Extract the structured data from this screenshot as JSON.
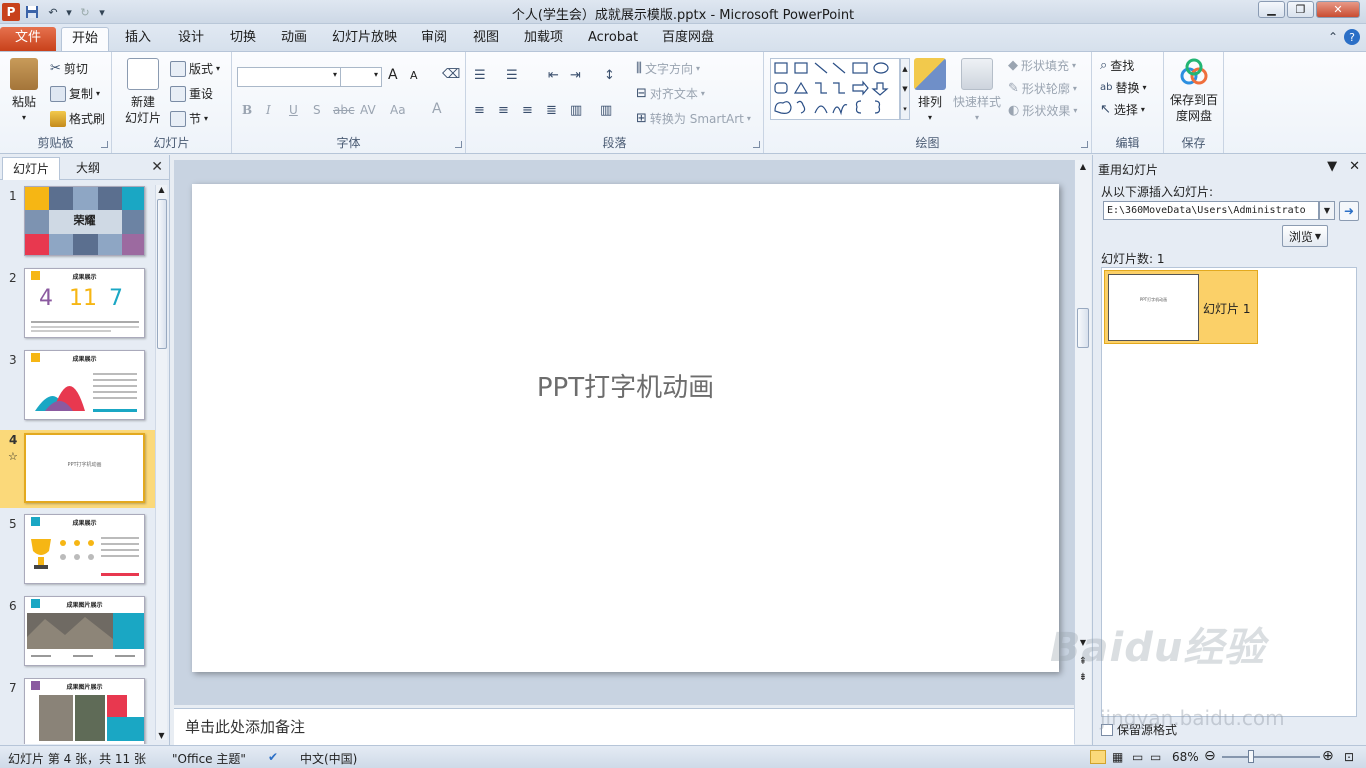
{
  "window": {
    "title": "个人(学生会）成就展示模版.pptx - Microsoft PowerPoint"
  },
  "qat": {
    "logo": "P",
    "save_icon": "save-icon",
    "undo_icon": "undo-icon",
    "redo_icon": "redo-icon"
  },
  "tabs": [
    "文件",
    "开始",
    "插入",
    "设计",
    "切换",
    "动画",
    "幻灯片放映",
    "审阅",
    "视图",
    "加载项",
    "Acrobat",
    "百度网盘"
  ],
  "active_tab": "开始",
  "ribbon": {
    "clipboard": {
      "label": "剪贴板",
      "paste": "粘贴",
      "cut": "剪切",
      "copy": "复制",
      "format_painter": "格式刷"
    },
    "slides": {
      "label": "幻灯片",
      "new_slide_1": "新建",
      "new_slide_2": "幻灯片",
      "layout": "版式",
      "reset": "重设",
      "section": "节"
    },
    "font": {
      "label": "字体",
      "grow": "A",
      "shrink": "A",
      "bold": "B",
      "italic": "I",
      "underline": "U",
      "shadow": "S",
      "strike": "abc",
      "spacing": "AV",
      "case": "Aa",
      "color": "A"
    },
    "paragraph": {
      "label": "段落",
      "text_direction": "文字方向",
      "align_text": "对齐文本",
      "smartart": "转换为 SmartArt"
    },
    "drawing": {
      "label": "绘图",
      "arrange": "排列",
      "quick_styles": "快速样式",
      "shape_fill": "形状填充",
      "shape_outline": "形状轮廓",
      "shape_effects": "形状效果"
    },
    "editing": {
      "label": "编辑",
      "find": "查找",
      "replace": "替换",
      "select": "选择"
    },
    "save": {
      "label": "保存",
      "save_baidu_1": "保存到百",
      "save_baidu_2": "度网盘"
    }
  },
  "left_pane": {
    "tabs": [
      "幻灯片",
      "大纲"
    ],
    "slides": [
      {
        "num": "1",
        "title": "荣耀"
      },
      {
        "num": "2",
        "title": "成果展示",
        "nums": [
          "4",
          "11",
          "7"
        ]
      },
      {
        "num": "3",
        "title": "成果展示"
      },
      {
        "num": "4",
        "title": "PPT打字机动画",
        "selected": true
      },
      {
        "num": "5",
        "title": "成果展示"
      },
      {
        "num": "6",
        "title": "成果图片展示"
      },
      {
        "num": "7",
        "title": "成果图片展示"
      }
    ],
    "selected_star": "☆"
  },
  "slide": {
    "title": "PPT打字机动画"
  },
  "notes": {
    "placeholder": "单击此处添加备注"
  },
  "right_pane": {
    "title": "重用幻灯片",
    "insert_from": "从以下源插入幻灯片:",
    "path": "E:\\360MoveData\\Users\\Administrato",
    "browse": "浏览",
    "count_label": "幻灯片数: 1",
    "item_label": "幻灯片 1",
    "item_preview": "PPT打字机动画",
    "keep_format": "保留源格式"
  },
  "status": {
    "slide_info": "幻灯片 第 4 张，共 11 张",
    "theme": "\"Office 主题\"",
    "language": "中文(中国)",
    "zoom": "68%",
    "zoom_fraction": 0.3
  },
  "watermark": {
    "line1": "Baidu经验",
    "line2": "jingyan.baidu.com"
  },
  "colors": {
    "file_tab": "#c8411b",
    "selected_slide": "#fbd97a",
    "accent_blue": "#2b6fc6"
  }
}
